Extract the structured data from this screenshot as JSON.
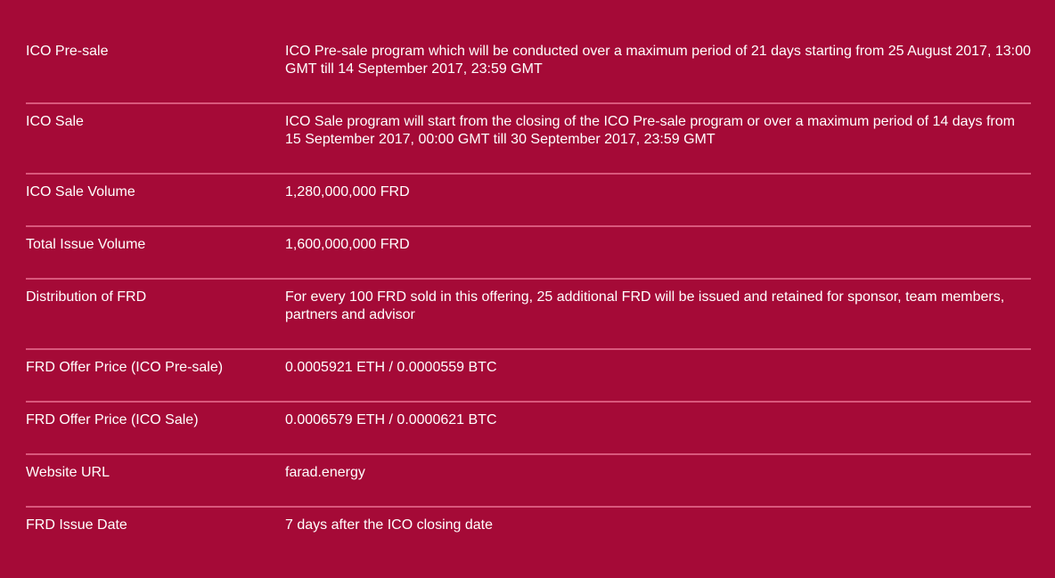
{
  "rows": [
    {
      "label": "ICO Pre-sale",
      "value": "ICO Pre-sale program which will be conducted over a maximum period of 21 days starting from 25 August 2017, 13:00 GMT till 14 September 2017, 23:59 GMT"
    },
    {
      "label": "ICO Sale",
      "value": "ICO Sale program will start from the closing of the ICO Pre-sale program or over a maximum period of 14 days from 15 September 2017, 00:00 GMT till 30 September 2017, 23:59 GMT"
    },
    {
      "label": "ICO Sale Volume",
      "value": "1,280,000,000 FRD"
    },
    {
      "label": "Total Issue Volume",
      "value": "1,600,000,000 FRD"
    },
    {
      "label": "Distribution of FRD",
      "value": "For every 100 FRD sold in this offering, 25 additional FRD will be issued and retained for sponsor, team members, partners and advisor"
    },
    {
      "label": "FRD Offer Price (ICO Pre-sale)",
      "value": "0.0005921 ETH / 0.0000559 BTC"
    },
    {
      "label": "FRD Offer Price (ICO Sale)",
      "value": "0.0006579 ETH / 0.0000621 BTC"
    },
    {
      "label": "Website URL",
      "value": "farad.energy"
    },
    {
      "label": "FRD Issue Date",
      "value": "7 days after the ICO closing date"
    }
  ]
}
